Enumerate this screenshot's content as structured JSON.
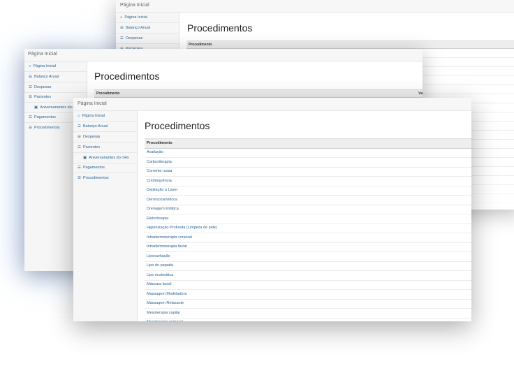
{
  "app": {
    "brand": "Página Inicial",
    "page_title": "Procedimentos",
    "nav": {
      "home": "Página Inicial",
      "balanco": "Balanço Anual",
      "despesas": "Despesas",
      "pacientes": "Pacientes",
      "aniversariantes": "Aniversariantes do mês",
      "aniversariantes_truncated": "Aniversariantes do mê",
      "pagamentos": "Pagamentos",
      "procedimentos": "Procedimentos",
      "back_truncated": "Pacientes"
    },
    "table": {
      "col_procedimento": "Procedimento",
      "col_valor_truncated": "Va",
      "rows": [
        "Avaliação",
        "Carboxiterapia",
        "Corrente russa",
        "Criofrequência",
        "Depilação a Laser",
        "Dermocosméticos",
        "Drenagem linfática",
        "Eletroterapia",
        "Higienização Profunda (Limpeza de pele)",
        "Intradermoterapia corporal",
        "Intradermoterapia facial",
        "Lipocavitação",
        "Lipo de papada",
        "Lipo enzimática",
        "Máscara facial",
        "Massagem Modeladora",
        "Massagem Relaxante",
        "Mesoterapia capilar",
        "Mesoterapia corporal"
      ]
    }
  },
  "colors": {
    "link": "#2a6496",
    "glow": "#8fbaf5",
    "header_bg": "#eeeeee"
  },
  "icons": {
    "home": "home-icon",
    "list": "list-icon",
    "birthday": "birthday-cake-icon"
  }
}
